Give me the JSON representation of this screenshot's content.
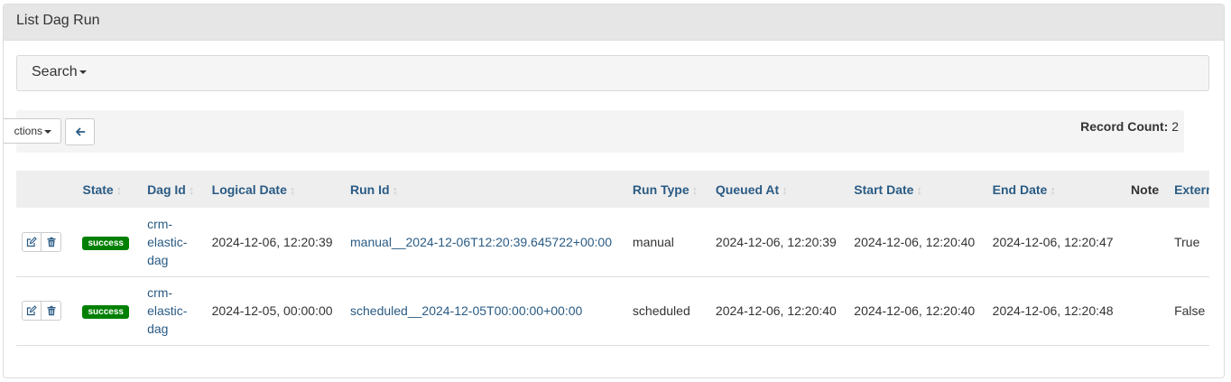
{
  "panel": {
    "title": "List Dag Run"
  },
  "search": {
    "label": "Search"
  },
  "toolbar": {
    "actions_label": "ctions",
    "record_count_label": "Record Count:",
    "record_count_value": "2"
  },
  "table": {
    "headers": {
      "state": "State",
      "dag_id": "Dag Id",
      "logical_date": "Logical Date",
      "run_id": "Run Id",
      "run_type": "Run Type",
      "queued_at": "Queued At",
      "start_date": "Start Date",
      "end_date": "End Date",
      "note": "Note",
      "external_trigger": "External T"
    },
    "rows": [
      {
        "state": "success",
        "dag_id": "crm-elastic-dag",
        "logical_date": "2024-12-06, 12:20:39",
        "run_id": "manual__2024-12-06T12:20:39.645722+00:00",
        "run_type": "manual",
        "queued_at": "2024-12-06, 12:20:39",
        "start_date": "2024-12-06, 12:20:40",
        "end_date": "2024-12-06, 12:20:47",
        "note": "",
        "external_trigger": "True"
      },
      {
        "state": "success",
        "dag_id": "crm-elastic-dag",
        "logical_date": "2024-12-05, 00:00:00",
        "run_id": "scheduled__2024-12-05T00:00:00+00:00",
        "run_type": "scheduled",
        "queued_at": "2024-12-06, 12:20:40",
        "start_date": "2024-12-06, 12:20:40",
        "end_date": "2024-12-06, 12:20:48",
        "note": "",
        "external_trigger": "False"
      }
    ]
  },
  "colors": {
    "link": "#2a5b84",
    "success": "#008000",
    "header_bg": "#eeeeee"
  }
}
